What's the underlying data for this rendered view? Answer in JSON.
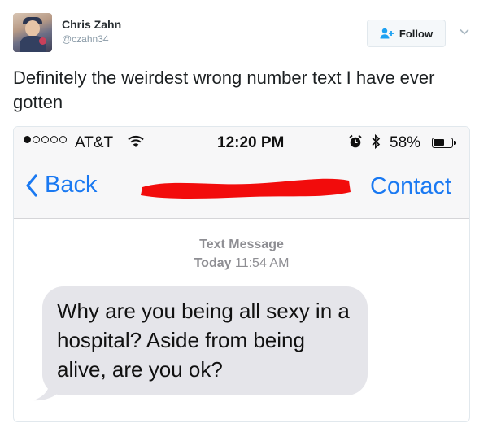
{
  "tweet": {
    "author": {
      "name": "Chris Zahn",
      "handle": "@czahn34"
    },
    "follow_label": "Follow",
    "text": "Definitely the weirdest wrong number text I have ever gotten"
  },
  "screenshot": {
    "status_bar": {
      "carrier": "AT&T",
      "time": "12:20 PM",
      "battery": "58%",
      "signal_bars_filled": 1,
      "signal_bars_total": 5
    },
    "nav": {
      "back_label": "Back",
      "contact_label": "Contact"
    },
    "conversation": {
      "type_label": "Text Message",
      "date_label": "Today",
      "time_label": "11:54 AM",
      "message": "Why are you being all sexy in a hospital? Aside from being alive, are you ok?"
    }
  },
  "colors": {
    "ios_blue": "#1a79f2",
    "redaction": "#f20c0c",
    "bubble_grey": "#e5e5ea"
  }
}
